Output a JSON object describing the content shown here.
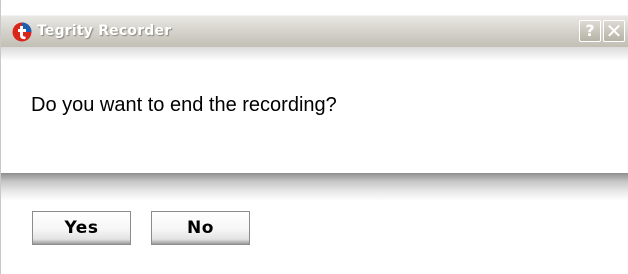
{
  "window": {
    "title": "Tegrity Recorder",
    "icon": "tegrity-logo-icon",
    "help_button_label": "?",
    "close_button_label": "✕"
  },
  "dialog": {
    "message": "Do you want to end the recording?",
    "yes_label": "Yes",
    "no_label": "No"
  },
  "colors": {
    "titlebar_top": "#e9e8e4",
    "titlebar_bottom": "#c2bfb5",
    "logo_red": "#d8261c",
    "logo_blue": "#1f5fb0"
  }
}
